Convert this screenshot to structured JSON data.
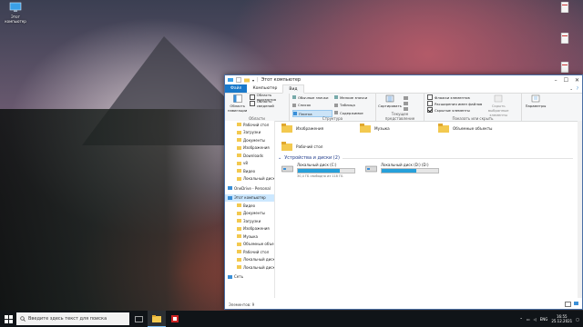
{
  "desktop": {
    "this_pc_label": "Этот\nкомпьютер"
  },
  "window": {
    "title": "Этот компьютер",
    "tabs": [
      "Файл",
      "Компьютер",
      "Вид"
    ],
    "ribbon": {
      "nav_pane": "Область навигации",
      "preview_pane": "Область просмотра",
      "details_pane": "Область сведений",
      "panes_group": "Области",
      "layout_items": [
        "Обычные значки",
        "Мелкие значки",
        "Список",
        "Таблица",
        "Плитка",
        "Содержимое"
      ],
      "layout_group": "Структура",
      "sort_label": "Сортировать",
      "current_view_group": "Текущее представление",
      "item_checkboxes": "Флажки элементов",
      "file_extensions": "Расширения имен файлов",
      "hidden_items": "Скрытые элементы",
      "hide_selected": "Скрыть выбранные элементы",
      "show_hide_group": "Показать или скрыть",
      "options": "Параметры"
    },
    "nav": [
      {
        "label": "Рабочий стол",
        "root": false
      },
      {
        "label": "Загрузки",
        "root": false
      },
      {
        "label": "Документы",
        "root": false
      },
      {
        "label": "Изображения",
        "root": false
      },
      {
        "label": "Downloads",
        "root": false
      },
      {
        "label": "v8",
        "root": false
      },
      {
        "label": "Видео",
        "root": false
      },
      {
        "label": "Локальный диск (D",
        "root": false
      },
      {
        "label": "OneDrive - Personal",
        "root": true
      },
      {
        "label": "Этот компьютер",
        "root": true,
        "selected": true
      },
      {
        "label": "Видео",
        "root": false
      },
      {
        "label": "Документы",
        "root": false
      },
      {
        "label": "Загрузки",
        "root": false
      },
      {
        "label": "Изображения",
        "root": false
      },
      {
        "label": "Музыка",
        "root": false
      },
      {
        "label": "Объемные объекты",
        "root": false
      },
      {
        "label": "Рабочий стол",
        "root": false
      },
      {
        "label": "Локальный диск (C",
        "root": false
      },
      {
        "label": "Локальный диск (D",
        "root": false
      },
      {
        "label": "Сеть",
        "root": true
      }
    ],
    "folders": [
      "Изображения",
      "Музыка",
      "Объемные объекты",
      "Рабочий стол"
    ],
    "devices_header": "Устройства и диски (2)",
    "drives": [
      {
        "name": "Локальный диск (C:)",
        "free": "30,4 ГБ свободно из 118 ГБ",
        "used_fraction": 0.74
      },
      {
        "name": "Локальный диск (D:) (D:)",
        "free": "",
        "used_fraction": 0.62
      }
    ],
    "status": "Элементов: 9"
  },
  "taskbar": {
    "search_placeholder": "Введите здесь текст для поиска",
    "lang": "ENG",
    "time": "16:55",
    "date": "25.12.2021"
  }
}
